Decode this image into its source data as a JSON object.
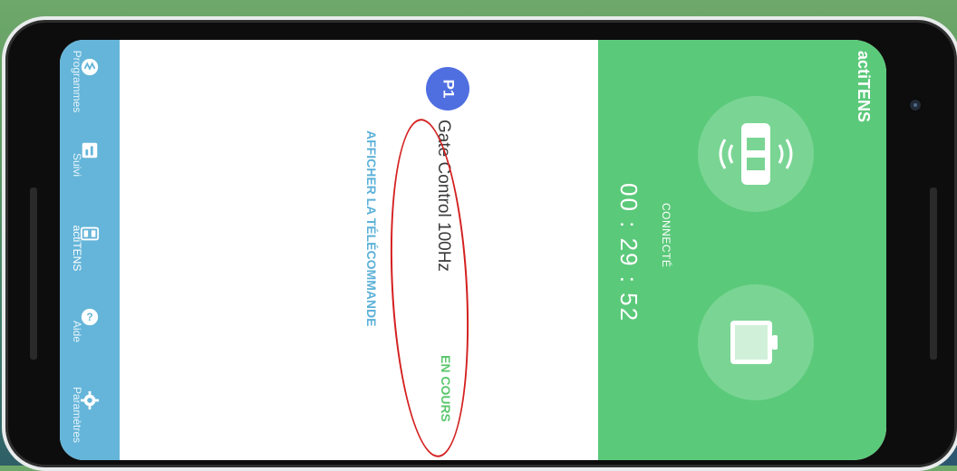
{
  "colors": {
    "sidebar": "#64b5d9",
    "accent_blue": "#5cb1d8",
    "status_green": "#5bc76d",
    "badge_blue": "#4f6fe0",
    "panel_green": "#5bc97a",
    "annotation_red": "#d41f1f"
  },
  "sidebar": {
    "items": [
      {
        "label": "Programmes",
        "icon": "programs-icon"
      },
      {
        "label": "Suivi",
        "icon": "chart-icon"
      },
      {
        "label": "actiTENS",
        "icon": "device-icon"
      },
      {
        "label": "Aide",
        "icon": "help-icon"
      },
      {
        "label": "Paramètres",
        "icon": "gear-icon"
      }
    ]
  },
  "program": {
    "badge": "P1",
    "title": "Gate Control 100Hz",
    "status": "EN COURS",
    "remote_link": "AFFICHER LA TÉLÉCOMMANDE"
  },
  "device_panel": {
    "title": "actiTENS",
    "connection": "CONNECTÉ",
    "timer": "00 : 29 : 52",
    "icons": [
      "device-signal-icon",
      "battery-icon"
    ]
  }
}
